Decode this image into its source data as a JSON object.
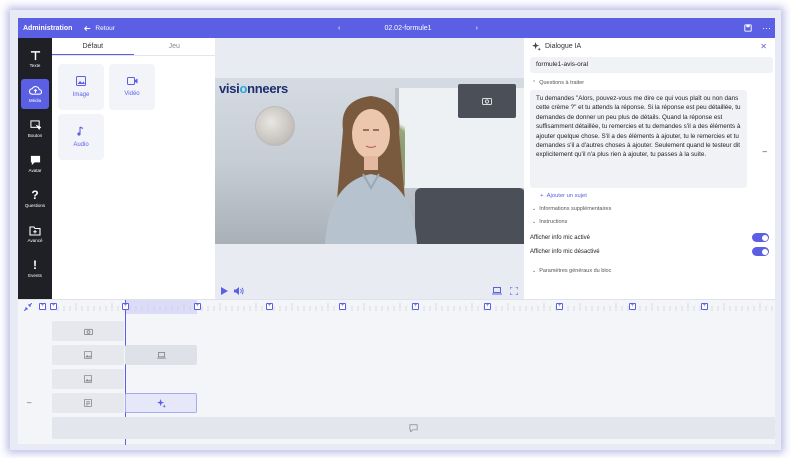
{
  "topbar": {
    "admin": "Administration",
    "back": "Retour",
    "title": "02.02-formule1"
  },
  "rail": [
    {
      "label": "Texte",
      "icon": "text-icon"
    },
    {
      "label": "Média",
      "icon": "cloud-upload-icon"
    },
    {
      "label": "Bouton",
      "icon": "cursor-icon"
    },
    {
      "label": "Avatar",
      "icon": "chat-icon"
    },
    {
      "label": "Questions",
      "icon": "question-icon"
    },
    {
      "label": "Avancé",
      "icon": "folder-plus-icon"
    },
    {
      "label": "Events",
      "icon": "exclamation-icon"
    }
  ],
  "panel": {
    "tabs": [
      "Défaut",
      "Jeu"
    ],
    "tiles": [
      {
        "label": "Image"
      },
      {
        "label": "Vidéo"
      },
      {
        "label": "Audio"
      }
    ]
  },
  "stage": {
    "logo_a": "visi",
    "logo_b": "o",
    "logo_c": "nneers"
  },
  "right": {
    "title": "Dialogue IA",
    "name": "formule1-avis-oral",
    "sect_questions": "Questions à traiter",
    "question_text": "Tu demandes \"Alors, pouvez-vous me dire ce qui vous plaît ou non dans cette crème ?\" et tu attends la réponse. Si la réponse est peu détaillée, tu demandes de donner un peu plus de détails. Quand la réponse est suffisamment détaillée, tu remercies et tu demandes s'il a des éléments à ajouter quelque chose. S'il a des éléments à ajouter, tu le remercies et tu demandes s'il a d'autres choses à ajouter. Seulement quand le testeur dit explicitement qu'il n'a plus rien à ajouter, tu passes à la suite.",
    "add_subject": "Ajouter un sujet",
    "sect_info": "Informations supplémentaires",
    "sect_instructions": "Instructions",
    "toggle_on": "Afficher info mic activé",
    "toggle_off": "Afficher info mic désactivé",
    "sect_params": "Paramètres généraux du bloc"
  },
  "colors": {
    "accent": "#5b5fe3",
    "rail": "#1f2026"
  }
}
